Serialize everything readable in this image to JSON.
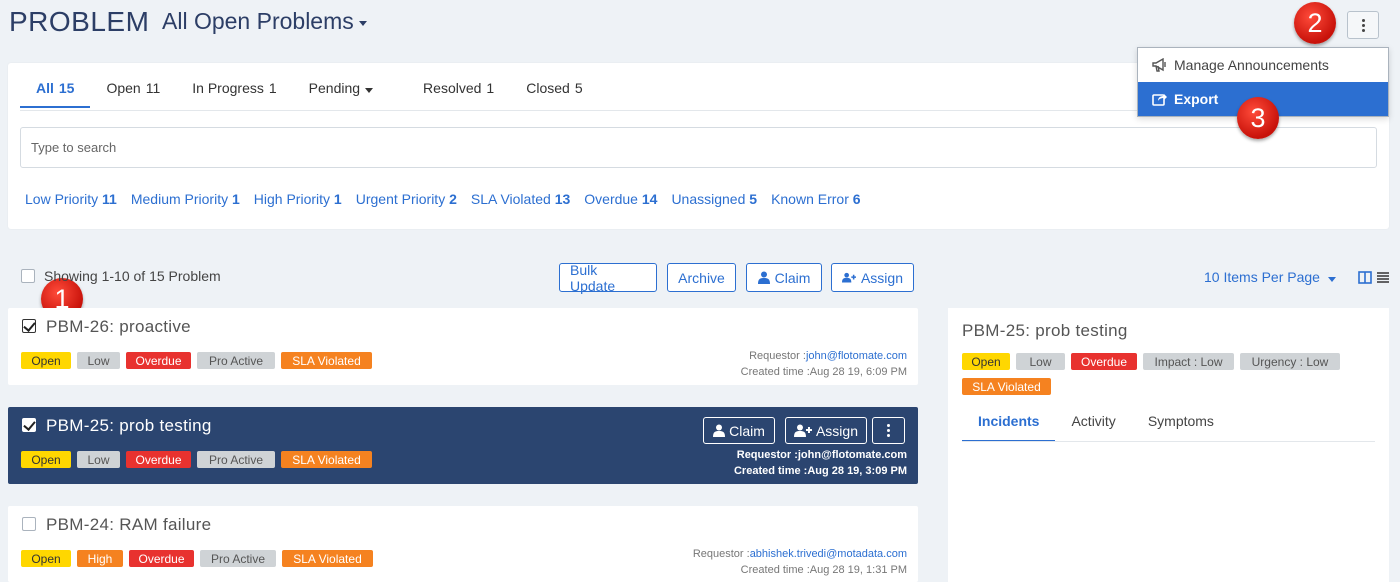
{
  "header": {
    "module": "PROBLEM",
    "view": "All Open Problems"
  },
  "menu": {
    "items": [
      {
        "label": "Manage Announcements",
        "icon": "megaphone-icon"
      },
      {
        "label": "Export",
        "icon": "share-icon"
      }
    ]
  },
  "callouts": {
    "one": "1",
    "two": "2",
    "three": "3"
  },
  "tabs": [
    {
      "label": "All",
      "count": "15"
    },
    {
      "label": "Open",
      "count": "11"
    },
    {
      "label": "In Progress",
      "count": "1"
    },
    {
      "label": "Pending",
      "count": ""
    },
    {
      "label": "Resolved",
      "count": "1"
    },
    {
      "label": "Closed",
      "count": "5"
    }
  ],
  "search": {
    "placeholder": "Type to search"
  },
  "quick_filters": [
    {
      "label": "Low Priority",
      "count": "11"
    },
    {
      "label": "Medium Priority",
      "count": "1"
    },
    {
      "label": "High Priority",
      "count": "1"
    },
    {
      "label": "Urgent Priority",
      "count": "2"
    },
    {
      "label": "SLA Violated",
      "count": "13"
    },
    {
      "label": "Overdue",
      "count": "14"
    },
    {
      "label": "Unassigned",
      "count": "5"
    },
    {
      "label": "Known Error",
      "count": "6"
    }
  ],
  "toolbar": {
    "showing": "Showing 1-10 of 15 Problem",
    "bulk_update": "Bulk Update",
    "archive": "Archive",
    "claim": "Claim",
    "assign": "Assign",
    "per_page": "10 Items Per Page"
  },
  "cards": [
    {
      "title": "PBM-26: proactive",
      "tags": [
        "Open",
        "Low",
        "Overdue",
        "Pro Active",
        "SLA Violated"
      ],
      "requestor_label": "Requestor :",
      "requestor": "john@flotomate.com",
      "created": "Created time :Aug 28 19, 6:09 PM"
    },
    {
      "title": "PBM-25: prob testing",
      "tags": [
        "Open",
        "Low",
        "Overdue",
        "Pro Active",
        "SLA Violated"
      ],
      "requestor_label": "Requestor :",
      "requestor": "john@flotomate.com",
      "created": "Created time :Aug 28 19, 3:09 PM",
      "claim": "Claim",
      "assign": "Assign"
    },
    {
      "title": "PBM-24: RAM failure",
      "tags": [
        "Open",
        "High",
        "Overdue",
        "Pro Active",
        "SLA Violated"
      ],
      "requestor_label": "Requestor :",
      "requestor": "abhishek.trivedi@motadata.com",
      "created": "Created time :Aug 28 19, 1:31 PM"
    }
  ],
  "detail": {
    "title": "PBM-25: prob testing",
    "tags": [
      "Open",
      "Low",
      "Overdue",
      "Impact : Low",
      "Urgency : Low",
      "SLA Violated"
    ],
    "tabs": [
      "Incidents",
      "Activity",
      "Symptoms"
    ]
  },
  "colors": {
    "accent": "#2c6fd1",
    "navy": "#2b4570",
    "callout": "#e0170e",
    "open": "#ffd700",
    "overdue": "#e8322f",
    "sla": "#f58220"
  }
}
